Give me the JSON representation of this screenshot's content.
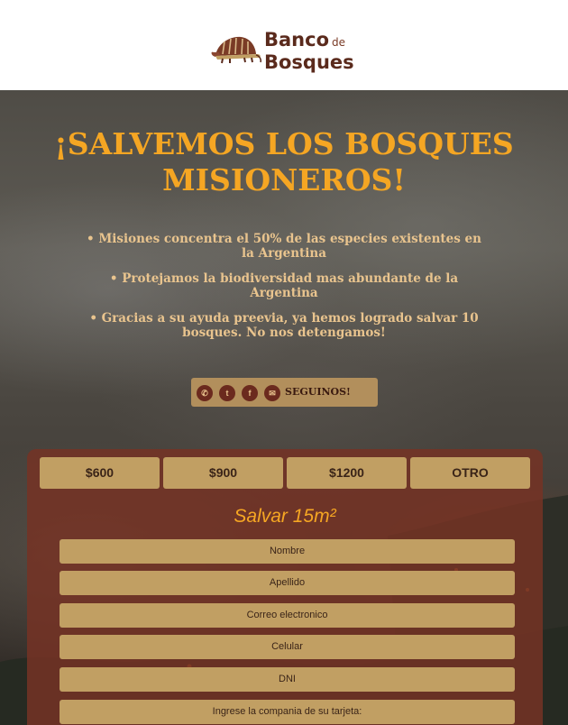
{
  "header": {
    "logo": {
      "line1": "Banco",
      "de": "de",
      "line2": "Bosques"
    }
  },
  "hero": {
    "title": "¡SALVEMOS LOS BOSQUES MISIONEROS!",
    "bullets": [
      "Misiones concentra el 50% de las especies existentes en la Argentina",
      "Protejamos la biodiversidad mas abundante de la Argentina",
      "Gracias a su ayuda preevia, ya hemos logrado salvar 10 bosques. No nos detengamos!"
    ],
    "social": {
      "label": "SEGUINOS!",
      "icons": [
        "whatsapp-icon",
        "twitter-icon",
        "facebook-icon",
        "email-icon"
      ]
    }
  },
  "donation": {
    "amounts": [
      "$600",
      "$900",
      "$1200",
      "OTRO"
    ],
    "heading": "Salvar 15m²",
    "fields": [
      {
        "placeholder": "Nombre"
      },
      {
        "placeholder": "Apellido"
      },
      {
        "placeholder": "Correo electronico"
      },
      {
        "placeholder": "Celular"
      },
      {
        "placeholder": "DNI"
      },
      {
        "placeholder": "Ingrese la compania de su tarjeta:"
      }
    ]
  },
  "colors": {
    "accent": "#f5a623",
    "brand": "#5a2a1c",
    "button": "#c19f63",
    "panel": "#763224",
    "bullet_text": "#e9c48e"
  }
}
